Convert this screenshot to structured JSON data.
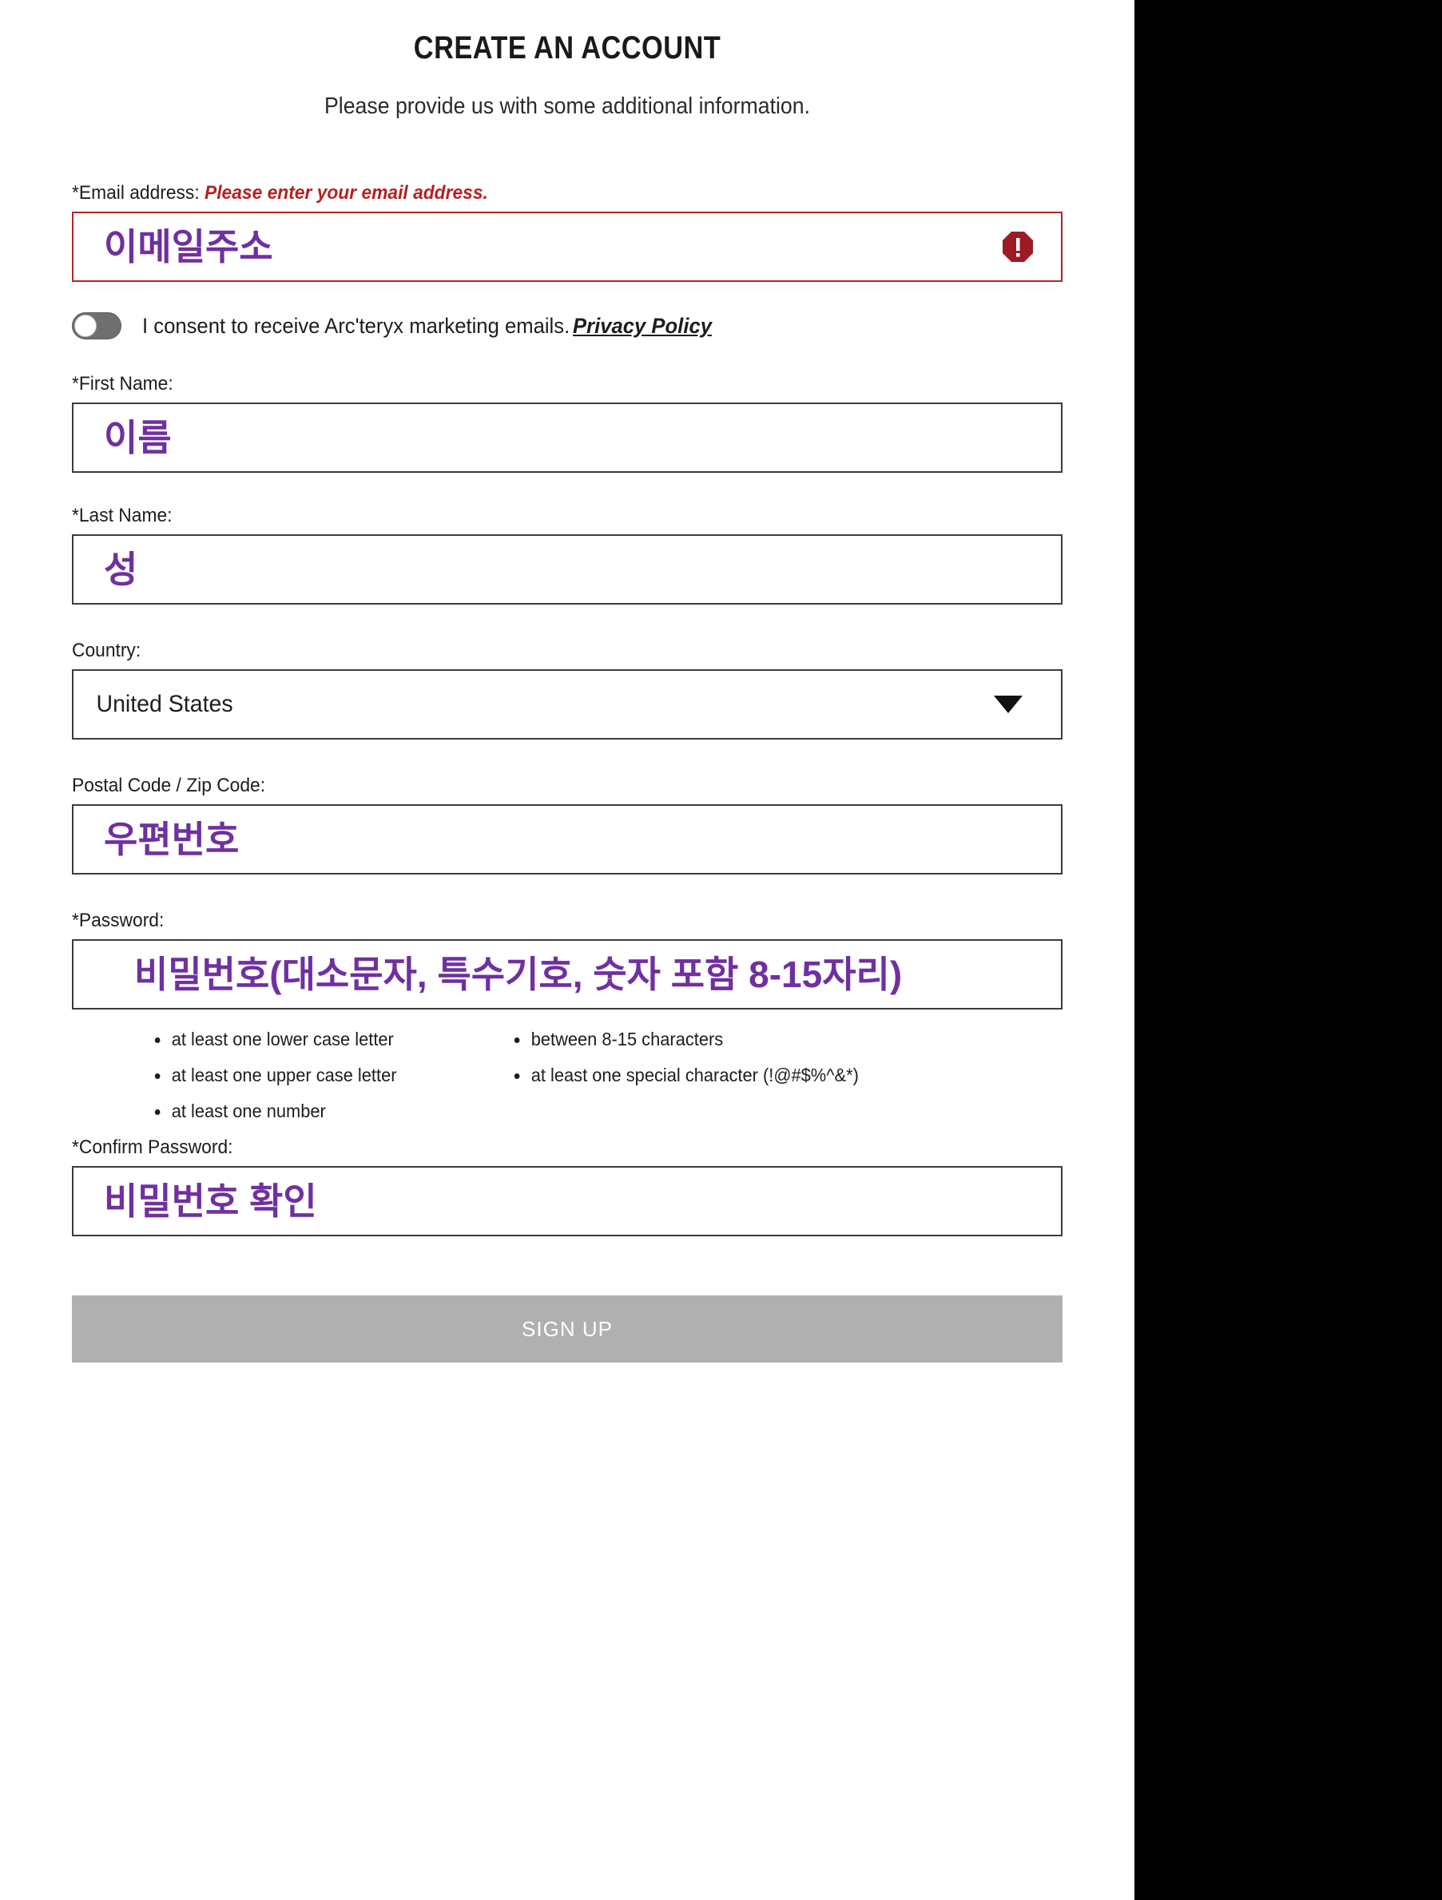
{
  "page": {
    "title": "CREATE AN ACCOUNT",
    "subtitle": "Please provide us with some additional information.",
    "panel_bg": "#ffffff",
    "outside_bg": "#000000",
    "value_color": "#7030a0",
    "error_color": "#b12626"
  },
  "email": {
    "label": "*Email address:",
    "label_required_mark": "*",
    "label_text": "Email address:",
    "error_message": "Please enter your email address.",
    "value": "이메일주소",
    "placeholder": "",
    "error_icon": "error-octagon-icon",
    "has_error": true
  },
  "consent": {
    "toggle_state": "off",
    "text": "I consent to receive Arc'teryx marketing emails.",
    "link_label": "Privacy Policy"
  },
  "first_name": {
    "label": "*First Name:",
    "value": "이름",
    "placeholder": ""
  },
  "last_name": {
    "label": "*Last Name:",
    "value": "성",
    "placeholder": ""
  },
  "country": {
    "label": "Country:",
    "selected": "United States",
    "caret_icon": "chevron-down-icon"
  },
  "postal_code": {
    "label": "Postal Code / Zip Code:",
    "value": "우편번호",
    "placeholder": ""
  },
  "password": {
    "label": "*Password:",
    "value": "비밀번호(대소문자, 특수기호, 숫자 포함 8-15자리)",
    "placeholder": "",
    "rules_left": [
      "at least one lower case letter",
      "at least one upper case letter",
      "at least one number"
    ],
    "rules_right": [
      "between 8-15 characters",
      "at least one special character (!@#$%^&*)"
    ]
  },
  "confirm_password": {
    "label": "*Confirm Password:",
    "value": "비밀번호 확인",
    "placeholder": ""
  },
  "submit": {
    "label": "SIGN UP",
    "disabled": true,
    "bg_color": "#b0b0b0"
  }
}
